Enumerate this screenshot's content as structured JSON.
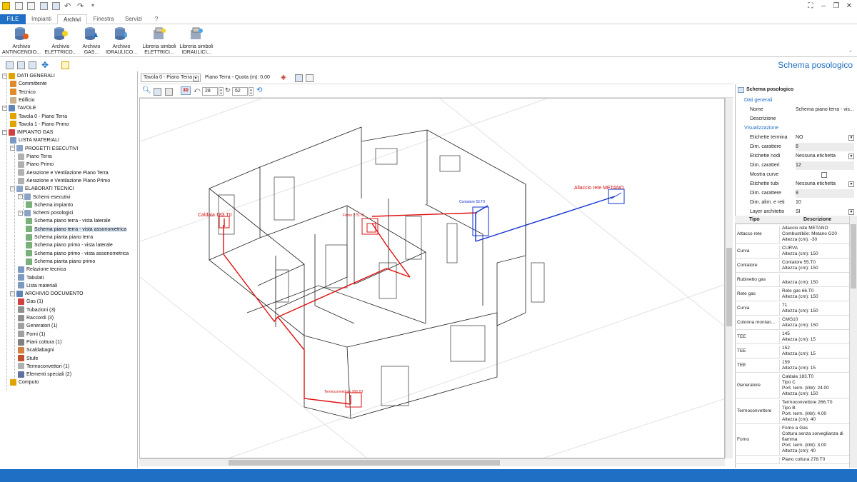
{
  "tabs": [
    {
      "label": "FILE"
    },
    {
      "label": "Impianti"
    },
    {
      "label": "Archivi"
    },
    {
      "label": "Finestra"
    },
    {
      "label": "Servizi"
    },
    {
      "label": "?"
    }
  ],
  "ribbon": {
    "buttons": [
      {
        "line1": "Archivio",
        "line2": "ANTINCENDIO..."
      },
      {
        "line1": "Archivio",
        "line2": "ELETTRICO..."
      },
      {
        "line1": "Archivio",
        "line2": "GAS..."
      },
      {
        "line1": "Archivio",
        "line2": "IDRAULICO..."
      },
      {
        "line1": "Libreria simboli",
        "line2": "ELETTRICI..."
      },
      {
        "line1": "Libreria simboli",
        "line2": "IDRAULICI..."
      }
    ]
  },
  "page_title": "Schema posologico",
  "tree": [
    {
      "label": "DATI GENERALI",
      "icon": "folder-gold-icon"
    },
    {
      "label": "Committente",
      "icon": "person-icon"
    },
    {
      "label": "Tecnico",
      "icon": "person-icon"
    },
    {
      "label": "Edificio",
      "icon": "building-icon"
    },
    {
      "label": "TAVOLE",
      "icon": "folder-blue-icon"
    },
    {
      "label": "Tavola 0 - Piano Terra",
      "icon": "pencil-icon"
    },
    {
      "label": "Tavola 1 - Piano Primo",
      "icon": "pencil-icon"
    },
    {
      "label": "IMPIANTO GAS",
      "icon": "gas-icon"
    },
    {
      "label": "LISTA MATERIALI",
      "icon": "list-icon"
    },
    {
      "label": "PROGETTI ESECUTIVI",
      "icon": "folder-icon"
    },
    {
      "label": "Piano Terra",
      "icon": "plan-icon"
    },
    {
      "label": "Piano Primo",
      "icon": "plan-icon"
    },
    {
      "label": "Aerazione e Ventilazione  Piano Terra",
      "icon": "plan-icon"
    },
    {
      "label": "Aerazione e Ventilazione  Piano Primo",
      "icon": "plan-icon"
    },
    {
      "label": "ELABORATI TECNICI",
      "icon": "folder-icon"
    },
    {
      "label": "Schemi esecutivi",
      "icon": "folder-icon"
    },
    {
      "label": "Schema impianto",
      "icon": "schema-icon"
    },
    {
      "label": "Schemi posologici",
      "icon": "folder-icon"
    },
    {
      "label": "Schema piano terra -  vista laterale",
      "icon": "schema-icon"
    },
    {
      "label": "Schema piano terra - vista assonometrica",
      "icon": "schema-icon"
    },
    {
      "label": "Schema pianta piano terra",
      "icon": "schema-icon"
    },
    {
      "label": "Schema piano primo - vista laterale",
      "icon": "schema-icon"
    },
    {
      "label": "Schema piano primo - vista assonometrica",
      "icon": "schema-icon"
    },
    {
      "label": "Schema pianta piano primo",
      "icon": "schema-icon"
    },
    {
      "label": "Relazione tecnica",
      "icon": "doc-icon"
    },
    {
      "label": "Tabulati",
      "icon": "doc-icon"
    },
    {
      "label": "Lista materiali",
      "icon": "doc-icon"
    },
    {
      "label": "ARCHIVIO DOCUMENTO",
      "icon": "archive-icon"
    },
    {
      "label": "Gas (1)",
      "icon": "gas-icon"
    },
    {
      "label": "Tubazioni (3)",
      "icon": "pipe-icon"
    },
    {
      "label": "Raccordi (3)",
      "icon": "fitting-icon"
    },
    {
      "label": "Generatori (1)",
      "icon": "boiler-icon"
    },
    {
      "label": "Forni (1)",
      "icon": "oven-icon"
    },
    {
      "label": "Piani cottura (1)",
      "icon": "hob-icon"
    },
    {
      "label": "Scaldabagni",
      "icon": "heater-icon"
    },
    {
      "label": "Stufe",
      "icon": "stove-icon"
    },
    {
      "label": "Termoconvettori (1)",
      "icon": "convector-icon"
    },
    {
      "label": "Elementi speciali (2)",
      "icon": "special-icon"
    },
    {
      "label": "Computo",
      "icon": "calc-icon"
    }
  ],
  "canvas_toolbar": {
    "tavola_select": "Tavola 0 - Piano Terra",
    "quota_label": "Piano Terra - Quota (m): 0.00"
  },
  "view_toolbar": {
    "rot_x": "28",
    "rot_y": "52"
  },
  "drawing_labels": {
    "allaccio": "Allaccio rete METANO",
    "caldaia": "Caldaia 183.T0",
    "contatore": "Contatore 55.T0",
    "termoconvettore": "Termoconvettore 266.T0",
    "forno": "Forno 275.T0"
  },
  "props": {
    "header": "Schema posologico",
    "section1": "Dati generali",
    "nome_k": "Nome",
    "nome_v": "Schema piano terra - vis...",
    "descr_k": "Descrizione",
    "section2": "Visualizzazione",
    "rows": [
      {
        "k": "Etichette termina",
        "v": "NO"
      },
      {
        "k": "Dim. carattere",
        "v": "8"
      },
      {
        "k": "Etichette nodi",
        "v": "Nessuna etichetta"
      },
      {
        "k": "Dim. caratteri",
        "v": "12"
      },
      {
        "k": "Mostra curve",
        "v": ""
      },
      {
        "k": "Etichette tubi",
        "v": "Nessuna etichetta"
      },
      {
        "k": "Dim. carattere",
        "v": "8"
      },
      {
        "k": "Dim. alim. e reti",
        "v": "10"
      },
      {
        "k": "Layer architetto",
        "v": "SI"
      }
    ]
  },
  "table": {
    "headers": [
      "Tipo",
      "Descrizione"
    ],
    "rows": [
      {
        "tipo": "Attacco rete",
        "desc": "Allaccio rete METANO\nCombustibile: Metano G20\nAltezza (cm): -30"
      },
      {
        "tipo": "Curva",
        "desc": "CURVA\nAltezza (cm): 150"
      },
      {
        "tipo": "Contatore",
        "desc": "Contatore 55.T0\nAltezza (cm): 150"
      },
      {
        "tipo": "Rubinetto gas",
        "desc": "\nAltezza (cm): 150"
      },
      {
        "tipo": "Rete gas",
        "desc": "Rete gas 66.T0\nAltezza (cm): 150"
      },
      {
        "tipo": "Curva",
        "desc": "71\nAltezza (cm): 150"
      },
      {
        "tipo": "Colonna montan...",
        "desc": "CMG10\nAltezza (cm): 150"
      },
      {
        "tipo": "TEE",
        "desc": "145\nAltezza (cm): 15"
      },
      {
        "tipo": "TEE",
        "desc": "152\nAltezza (cm): 15"
      },
      {
        "tipo": "TEE",
        "desc": "159\nAltezza (cm): 15"
      },
      {
        "tipo": "Generatore",
        "desc": "Caldaia 183.T0\nTipo C\nPort. term. (kW): 24.00\nAltezza (cm): 150"
      },
      {
        "tipo": "Termoconvettore",
        "desc": "Termoconvettore 266.T0\nTipo B\nPort. term. (kW): 4.00\nAltezza (cm): 40"
      },
      {
        "tipo": "Forno",
        "desc": "Forno a Gas\nCottura senza sorveglianza di\nfiamma\nPort. term. (kW): 3.00\nAltezza (cm): 40"
      },
      {
        "tipo": "",
        "desc": "Piano cottura 278.T0"
      }
    ]
  },
  "colors": {
    "accent": "#1f6fc5",
    "gas_pipe": "#e01010",
    "network_pipe": "#1030d0"
  }
}
